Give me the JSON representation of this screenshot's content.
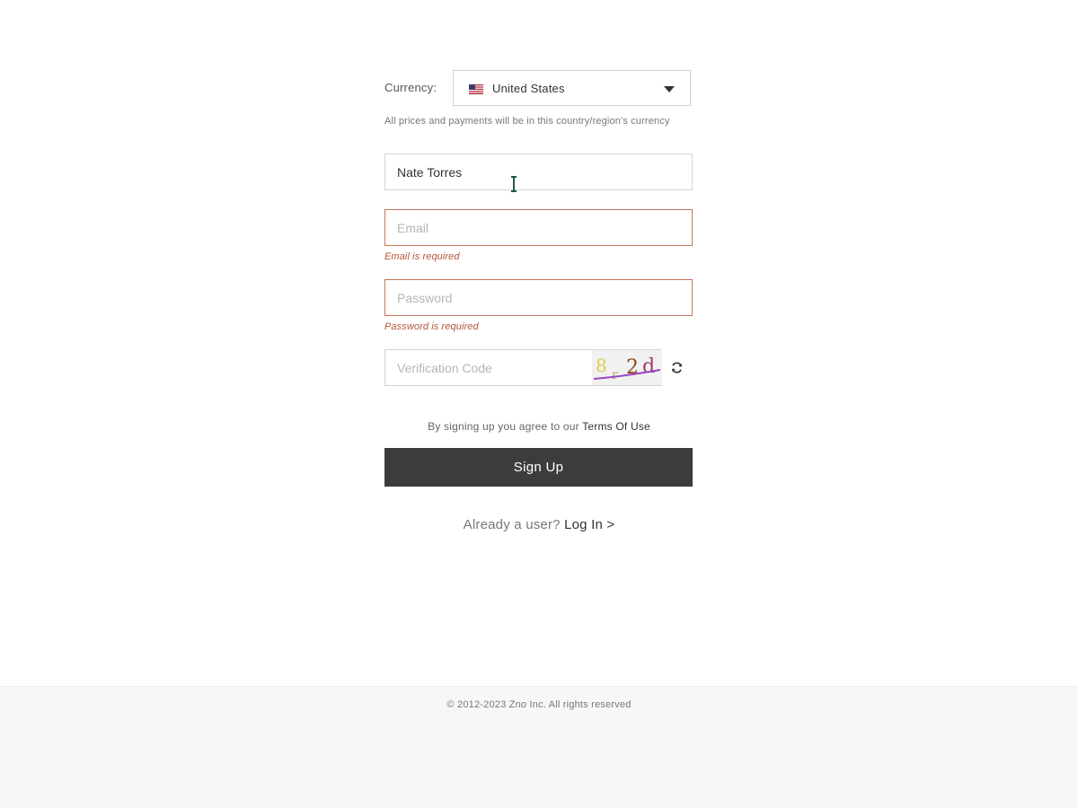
{
  "currency": {
    "label": "Currency:",
    "selected": "United States",
    "flag_icon": "us-flag-icon",
    "note": "All prices and payments will be in this country/region's currency"
  },
  "form": {
    "name": {
      "value": "Nate Torres",
      "placeholder": ""
    },
    "email": {
      "value": "",
      "placeholder": "Email",
      "error": "Email is required"
    },
    "password": {
      "value": "",
      "placeholder": "Password",
      "error": "Password is required"
    },
    "verification": {
      "value": "",
      "placeholder": "Verification Code",
      "captcha_text": "8r2d"
    }
  },
  "terms": {
    "prefix": "By signing up you agree to our ",
    "link": "Terms Of Use"
  },
  "signup_button": "Sign Up",
  "login": {
    "prefix": "Already a user? ",
    "link": "Log In >"
  },
  "footer": {
    "copyright": "© 2012-2023 Zno Inc. All rights reserved"
  },
  "colors": {
    "button_bg": "#3c3c3c",
    "error": "#b5553a",
    "error_border": "#c8745a",
    "footer_bg": "#f7f7f7"
  }
}
